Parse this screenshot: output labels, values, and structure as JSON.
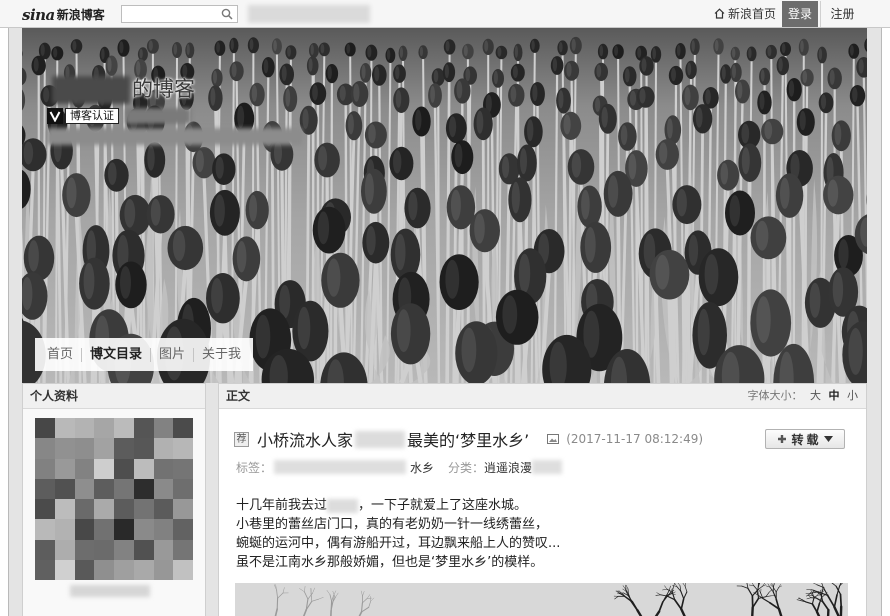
{
  "topbar": {
    "logo_brand": "sina",
    "logo_product": "新浪博客",
    "search": {
      "value": "",
      "placeholder": ""
    },
    "home_link": "新浪首页",
    "login": "登录",
    "register": "注册"
  },
  "banner": {
    "blog_title": "的博客",
    "verified_badge": "博客认证",
    "nav": [
      {
        "label": "首页",
        "active": false
      },
      {
        "label": "博文目录",
        "active": true
      },
      {
        "label": "图片",
        "active": false
      },
      {
        "label": "关于我",
        "active": false
      }
    ]
  },
  "sidebar": {
    "heading": "个人资料"
  },
  "main": {
    "heading": "正文",
    "font_size_label": "字体大小：",
    "font_sizes": [
      "大",
      "中",
      "小"
    ],
    "font_size_selected_index": 1
  },
  "article": {
    "badge": "荐",
    "title_before": "小桥流水人家",
    "title_after": "最美的‘梦里水乡’",
    "date": "(2017-11-17 08:12:49)",
    "share_button": "转载",
    "tags_label": "标签：",
    "tag": "水乡",
    "category_label": "分类：",
    "category": "逍遥浪漫",
    "body": {
      "line1_before": "十几年前我去过",
      "line1_after": "，一下子就爱上了这座水城。",
      "lines": [
        "小巷里的蕾丝店门口，真的有老奶奶一针一线绣蕾丝，",
        "蜿蜒的运河中，偶有游船开过，耳边飘来船上人的赞叹...",
        "虽不是江南水乡那般娇媚，但也是‘梦里水乡’的模样。"
      ]
    }
  },
  "icons": {
    "search": "search-icon",
    "home": "home-icon",
    "verified": "verified-v-icon",
    "image": "image-icon",
    "repost": "plus-icon",
    "dropdown": "dropdown-arrow-icon"
  },
  "colors": {
    "login_bg": "#6d6d6d",
    "frame_bg": "#e4e4e4",
    "topbar_bg": "#f6f6f6",
    "text_dark": "#333333",
    "text_muted": "#8a8a8a",
    "active_tab": "#222222"
  }
}
